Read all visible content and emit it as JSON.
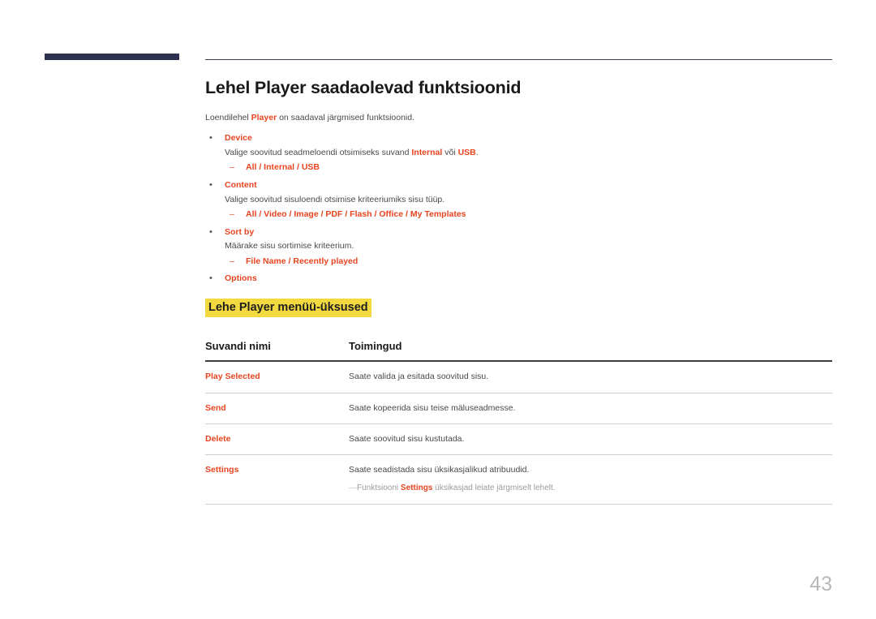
{
  "document": {
    "page_number": "43",
    "title": "Lehel Player saadaolevad funktsioonid",
    "intro": {
      "before": "Loendilehel ",
      "keyword": "Player",
      "after": " on saadaval järgmised funktsioonid."
    }
  },
  "features": [
    {
      "name": "Device",
      "description_before": "Valige soovitud seadmeloendi otsimiseks suvand ",
      "description_kw1": "Internal",
      "description_mid": " või ",
      "description_kw2": "USB",
      "description_after": ".",
      "options": "All / Internal / USB"
    },
    {
      "name": "Content",
      "description_before": "Valige soovitud sisuloendi otsimise kriteeriumiks sisu tüüp.",
      "description_kw1": "",
      "description_mid": "",
      "description_kw2": "",
      "description_after": "",
      "options": "All / Video / Image / PDF / Flash / Office / My Templates"
    },
    {
      "name": "Sort by",
      "description_before": "Määrake sisu sortimise kriteerium.",
      "description_kw1": "",
      "description_mid": "",
      "description_kw2": "",
      "description_after": "",
      "options": "File Name / Recently played"
    },
    {
      "name": "Options",
      "description_before": "",
      "description_kw1": "",
      "description_mid": "",
      "description_kw2": "",
      "description_after": "",
      "options": ""
    }
  ],
  "sub_heading": "Lehe Player menüü-üksused",
  "table": {
    "headers": [
      "Suvandi nimi",
      "Toimingud"
    ],
    "rows": [
      {
        "name": "Play Selected",
        "action": "Saate valida ja esitada soovitud sisu."
      },
      {
        "name": "Send",
        "action": "Saate kopeerida sisu teise mäluseadmesse."
      },
      {
        "name": "Delete",
        "action": "Saate soovitud sisu kustutada."
      },
      {
        "name": "Settings",
        "action": "Saate seadistada sisu üksikasjalikud atribuudid."
      }
    ],
    "note": {
      "dash": "―",
      "before": "Funktsiooni ",
      "keyword": "Settings",
      "after": " üksikasjad leiate järgmiselt lehelt."
    }
  },
  "colors": {
    "accent_red": "#e8441f",
    "highlight_yellow": "#f2d93f",
    "navy": "#2e3050",
    "page_number_gray": "#b8b8b8"
  }
}
